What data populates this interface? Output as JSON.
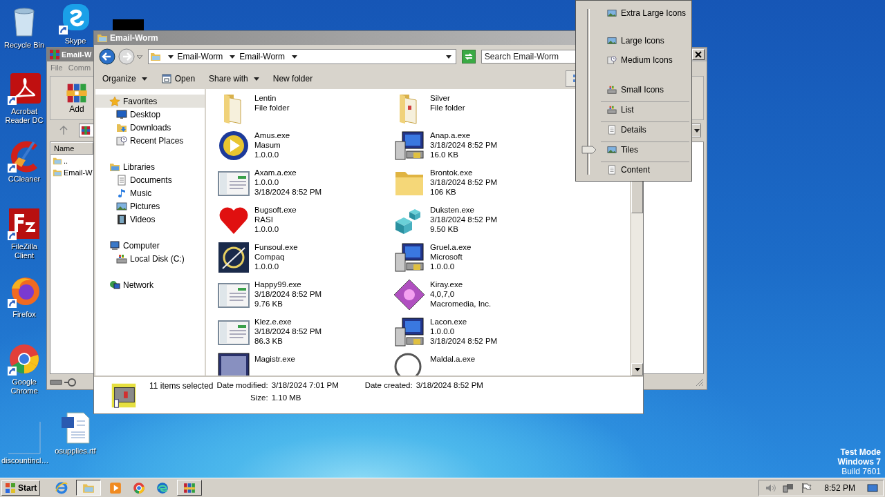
{
  "desktop_icons": [
    {
      "label": "Recycle Bin"
    },
    {
      "label": "Acrobat Reader DC"
    },
    {
      "label": "CCleaner"
    },
    {
      "label": "FileZilla Client"
    },
    {
      "label": "Firefox"
    },
    {
      "label": "Google Chrome"
    },
    {
      "label": "discountincl…"
    },
    {
      "label": "Skype"
    },
    {
      "label": "osupplies.rtf"
    }
  ],
  "archive_window": {
    "title": "Email-W",
    "menu": [
      "File",
      "Comm"
    ],
    "toolbar": [
      "Add"
    ],
    "column": "Name",
    "rows": [
      {
        "name": ".."
      },
      {
        "name": "Email-W"
      }
    ]
  },
  "explorer": {
    "title": "Email-Worm",
    "breadcrumb": [
      "Email-Worm",
      "Email-Worm"
    ],
    "search": {
      "placeholder": "Search Email-Worm"
    },
    "toolbar": [
      {
        "label": "Organize",
        "dropdown": true
      },
      {
        "label": "Open",
        "dropdown": false
      },
      {
        "label": "Share with",
        "dropdown": true
      },
      {
        "label": "New folder",
        "dropdown": false
      }
    ],
    "nav": [
      {
        "label": "Favorites",
        "selected": true,
        "children": [
          {
            "label": "Desktop",
            "selected": false
          },
          {
            "label": "Downloads",
            "selected": false
          },
          {
            "label": "Recent Places",
            "selected": false
          }
        ]
      },
      {
        "label": "Libraries",
        "selected": false,
        "children": [
          {
            "label": "Documents",
            "selected": false
          },
          {
            "label": "Music",
            "selected": false
          },
          {
            "label": "Pictures",
            "selected": false
          },
          {
            "label": "Videos",
            "selected": false
          }
        ]
      },
      {
        "label": "Computer",
        "selected": false,
        "children": [
          {
            "label": "Local Disk (C:)",
            "selected": false
          }
        ]
      },
      {
        "label": "Network",
        "selected": false
      }
    ],
    "items": [
      {
        "name": "Lentin",
        "lines": [
          "File folder"
        ]
      },
      {
        "name": "Silver",
        "lines": [
          "File folder"
        ]
      },
      {
        "name": "Amus.exe",
        "lines": [
          "Masum",
          "1.0.0.0"
        ]
      },
      {
        "name": "Anap.a.exe",
        "lines": [
          "3/18/2024 8:52 PM",
          "16.0 KB"
        ]
      },
      {
        "name": "Axam.a.exe",
        "lines": [
          "1.0.0.0",
          "3/18/2024 8:52 PM"
        ]
      },
      {
        "name": "Brontok.exe",
        "lines": [
          "3/18/2024 8:52 PM",
          "106 KB"
        ]
      },
      {
        "name": "Bugsoft.exe",
        "lines": [
          "RASI",
          "1.0.0.0"
        ]
      },
      {
        "name": "Duksten.exe",
        "lines": [
          "3/18/2024 8:52 PM",
          "9.50 KB"
        ]
      },
      {
        "name": "Funsoul.exe",
        "lines": [
          "Compaq",
          "1.0.0.0"
        ]
      },
      {
        "name": "Gruel.a.exe",
        "lines": [
          "Microsoft",
          "1.0.0.0"
        ]
      },
      {
        "name": "Happy99.exe",
        "lines": [
          "3/18/2024 8:52 PM",
          "9.76 KB"
        ]
      },
      {
        "name": "Kiray.exe",
        "lines": [
          "4,0,7,0",
          "Macromedia, Inc."
        ]
      },
      {
        "name": "Klez.e.exe",
        "lines": [
          "3/18/2024 8:52 PM",
          "86.3 KB"
        ]
      },
      {
        "name": "Lacon.exe",
        "lines": [
          "1.0.0.0",
          "3/18/2024 8:52 PM"
        ]
      },
      {
        "name": "Magistr.exe"
      },
      {
        "name": "Maldal.a.exe"
      }
    ],
    "details": {
      "summary": "11 items selected",
      "fields": [
        {
          "label": "Date modified:",
          "value": "3/18/2024 7:01 PM"
        },
        {
          "label": "Date created:",
          "value": "3/18/2024 8:52 PM"
        },
        {
          "label": "Size:",
          "value": "1.10 MB"
        }
      ]
    }
  },
  "view_menu": {
    "items": [
      {
        "label": "Extra Large Icons",
        "kind": "scale",
        "selected": false
      },
      {
        "label": "Large Icons",
        "kind": "scale",
        "selected": false
      },
      {
        "label": "Medium Icons",
        "kind": "scale",
        "selected": false
      },
      {
        "label": "Small Icons",
        "kind": "scale",
        "selected": false
      },
      {
        "label": "List",
        "kind": "fixed",
        "selected": false
      },
      {
        "label": "Details",
        "kind": "fixed",
        "selected": false
      },
      {
        "label": "Tiles",
        "kind": "fixed",
        "selected": true
      },
      {
        "label": "Content",
        "kind": "fixed",
        "selected": false
      }
    ]
  },
  "os_notice": [
    "Test Mode",
    "Windows 7",
    "Build 7601"
  ],
  "taskbar": {
    "start": "Start",
    "apps": [
      {
        "selected": false,
        "running": false
      },
      {
        "selected": true,
        "running": true
      },
      {
        "selected": false,
        "running": false
      },
      {
        "selected": false,
        "running": false
      },
      {
        "selected": false,
        "running": false
      },
      {
        "selected": false,
        "running": true
      }
    ],
    "clock": "8:52 PM"
  }
}
